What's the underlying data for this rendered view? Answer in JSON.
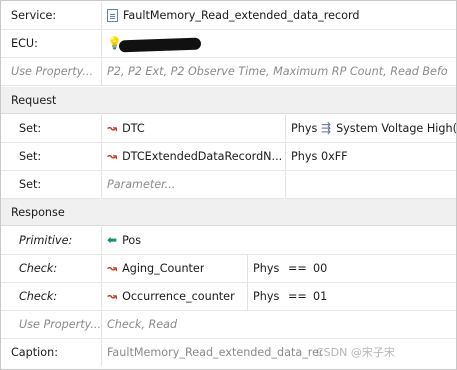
{
  "service": {
    "label": "Service:",
    "value": "FaultMemory_Read_extended_data_record",
    "icon": "document-icon"
  },
  "ecu": {
    "label": "ECU:",
    "icon": "bulb-icon"
  },
  "use_property_top": {
    "label": "Use Property...",
    "value": "P2, P2 Ext, P2 Observe Time, Maximum RP Count, Read Befo..."
  },
  "request": {
    "header": "Request",
    "rows": [
      {
        "label": "Set:",
        "name": "DTC",
        "phys": "Phys",
        "value": "System Voltage High("
      },
      {
        "label": "Set:",
        "name": "DTCExtendedDataRecordN...",
        "phys": "Phys",
        "value": "0xFF"
      },
      {
        "label": "Set:",
        "placeholder": "Parameter..."
      }
    ]
  },
  "response": {
    "header": "Response",
    "primitive": {
      "label": "Primitive:",
      "value": "Pos"
    },
    "checks": [
      {
        "label": "Check:",
        "name": "Aging_Counter",
        "phys": "Phys",
        "op": "==",
        "value": "00"
      },
      {
        "label": "Check:",
        "name": "Occurrence_counter",
        "phys": "Phys",
        "op": "==",
        "value": "01"
      }
    ],
    "use_property": {
      "label": "Use Property...",
      "value": "Check, Read"
    }
  },
  "caption": {
    "label": "Caption:",
    "value": "FaultMemory_Read_extended_data_record: DTC..."
  },
  "watermark": "CSDN @宋子宋"
}
